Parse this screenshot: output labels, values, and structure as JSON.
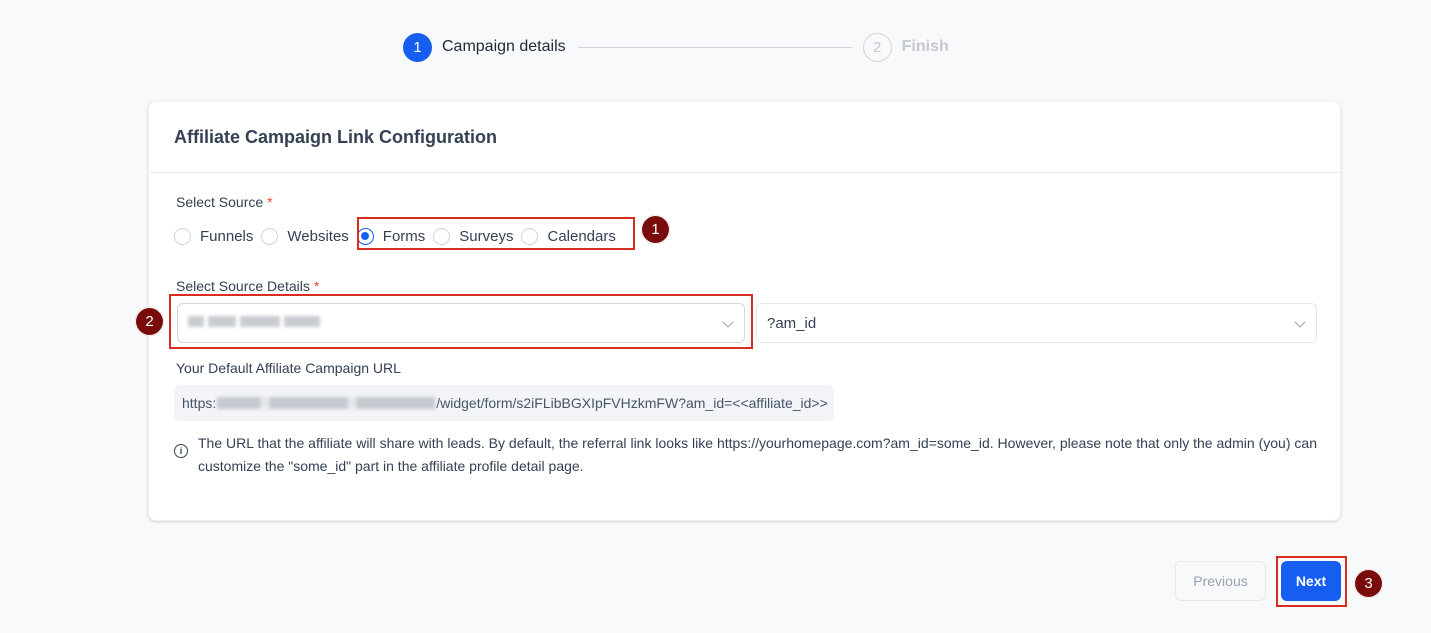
{
  "stepper": {
    "steps": [
      {
        "number": "1",
        "label": "Campaign details",
        "state": "active"
      },
      {
        "number": "2",
        "label": "Finish",
        "state": "inactive"
      }
    ]
  },
  "card": {
    "title": "Affiliate Campaign Link Configuration",
    "source": {
      "label": "Select Source",
      "required_mark": "*",
      "options": [
        "Funnels",
        "Websites",
        "Forms",
        "Surveys",
        "Calendars"
      ],
      "selected": "Forms"
    },
    "source_details": {
      "label": "Select Source Details",
      "required_mark": "*",
      "selected_value_redacted": true,
      "param_select_value": "?am_id"
    },
    "url": {
      "label": "Your Default Affiliate Campaign URL",
      "prefix": "https:",
      "suffix": "/widget/form/s2iFLibBGXIpFVHzkmFW?am_id=<<affiliate_id>>"
    },
    "info_text": "The URL that the affiliate will share with leads. By default, the referral link looks like https://yourhomepage.com?am_id=some_id. However, please note that only the admin (you) can customize the \"some_id\" part in the affiliate profile detail page."
  },
  "footer": {
    "previous_label": "Previous",
    "next_label": "Next"
  },
  "annotations": [
    "1",
    "2",
    "3"
  ],
  "colors": {
    "accent": "#155eef",
    "annotation_red": "#d92d20",
    "badge_bg": "#7a0b0b"
  }
}
